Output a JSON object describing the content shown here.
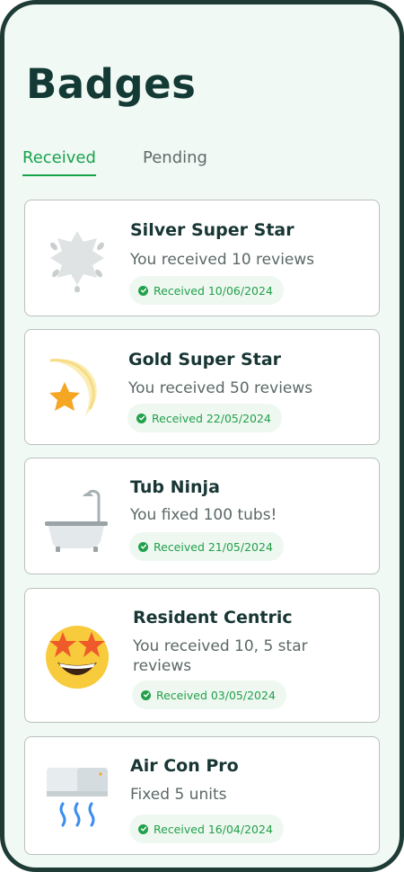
{
  "page": {
    "title": "Badges"
  },
  "tabs": [
    {
      "label": "Received",
      "active": true
    },
    {
      "label": "Pending",
      "active": false
    }
  ],
  "badges": [
    {
      "name": "Silver Super Star",
      "description": "You received 10 reviews",
      "received_label": "Received",
      "date": "10/06/2024",
      "icon": "silver-star-icon"
    },
    {
      "name": "Gold Super Star",
      "description": "You received 50 reviews",
      "received_label": "Received",
      "date": "22/05/2024",
      "icon": "shooting-star-icon"
    },
    {
      "name": "Tub Ninja",
      "description": "You fixed 100 tubs!",
      "received_label": "Received",
      "date": "21/05/2024",
      "icon": "bathtub-icon"
    },
    {
      "name": "Resident Centric",
      "description": "You received 10, 5 star reviews",
      "received_label": "Received",
      "date": "03/05/2024",
      "icon": "star-struck-emoji-icon"
    },
    {
      "name": "Air Con Pro",
      "description": "Fixed 5 units",
      "received_label": "Received",
      "date": "16/04/2024",
      "icon": "air-conditioner-icon"
    }
  ],
  "colors": {
    "accent": "#16a34a",
    "background": "#f1f9f5",
    "title": "#143a36",
    "badge_bg": "#eef8f1"
  }
}
